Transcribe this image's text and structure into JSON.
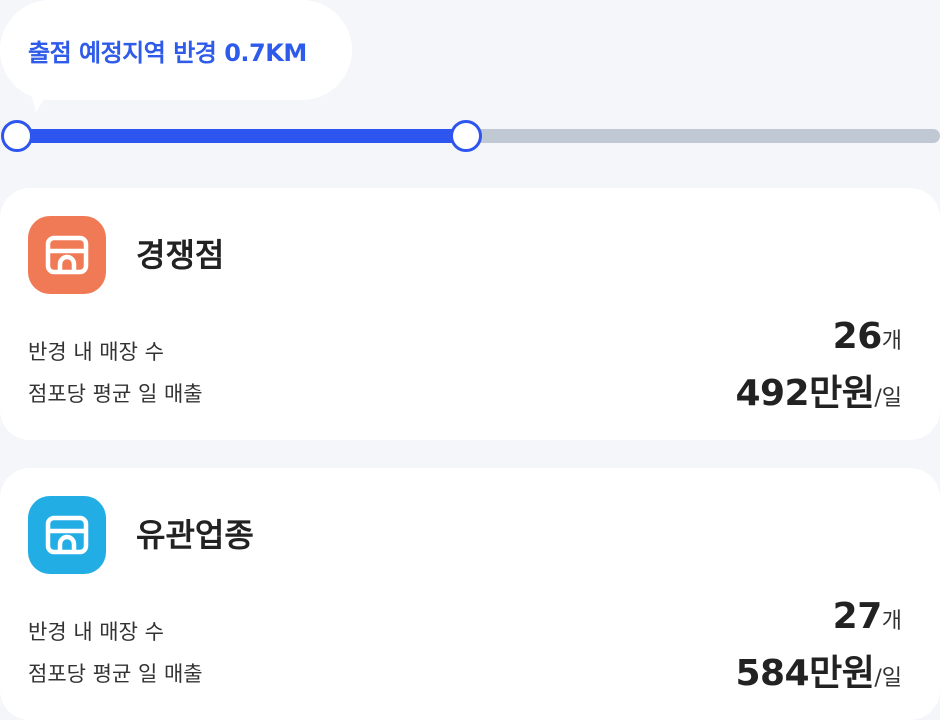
{
  "radius": {
    "label": "출점 예정지역 반경 0.7KM",
    "range_start": 0.0,
    "range_end": 0.485,
    "accent_color": "#2e55f0",
    "track_color": "#bfc8d3"
  },
  "cards": [
    {
      "title": "경쟁점",
      "icon": "store-icon",
      "icon_color": "#ef7a55",
      "store_count_label": "반경 내 매장 수",
      "store_count_value": "26",
      "store_count_unit": "개",
      "avg_sales_label": "점포당 평균 일 매출",
      "avg_sales_value": "492만원",
      "avg_sales_unit": "/일"
    },
    {
      "title": "유관업종",
      "icon": "store-icon",
      "icon_color": "#22aee5",
      "store_count_label": "반경 내 매장 수",
      "store_count_value": "27",
      "store_count_unit": "개",
      "avg_sales_label": "점포당 평균 일 매출",
      "avg_sales_value": "584만원",
      "avg_sales_unit": "/일"
    }
  ]
}
